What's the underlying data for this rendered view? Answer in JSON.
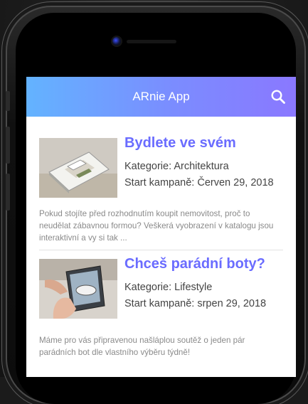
{
  "app": {
    "title": "ARnie App",
    "search_icon": "search-icon"
  },
  "colors": {
    "accent": "#6a6cff",
    "header_start": "#63b3ff",
    "header_end": "#8a78ff"
  },
  "feed": {
    "items": [
      {
        "title": "Bydlete ve svém",
        "category": "Kategorie: Architektura",
        "start": "Start kampaně: Červen 29, 2018",
        "description": "Pokud stojíte před rozhodnutím koupit nemovitost, proč to neudělat zábavnou formou? Veškerá vyobrazení v katalogu jsou interaktivní a vy si tak ..."
      },
      {
        "title": "Chceš parádní boty?",
        "category": "Kategorie: Lifestyle",
        "start": "Start kampaně: srpen 29, 2018",
        "description": "Máme pro vás připravenou našláplou soutěž o jeden pár parádních bot dle vlastního výběru týdně!"
      }
    ]
  }
}
